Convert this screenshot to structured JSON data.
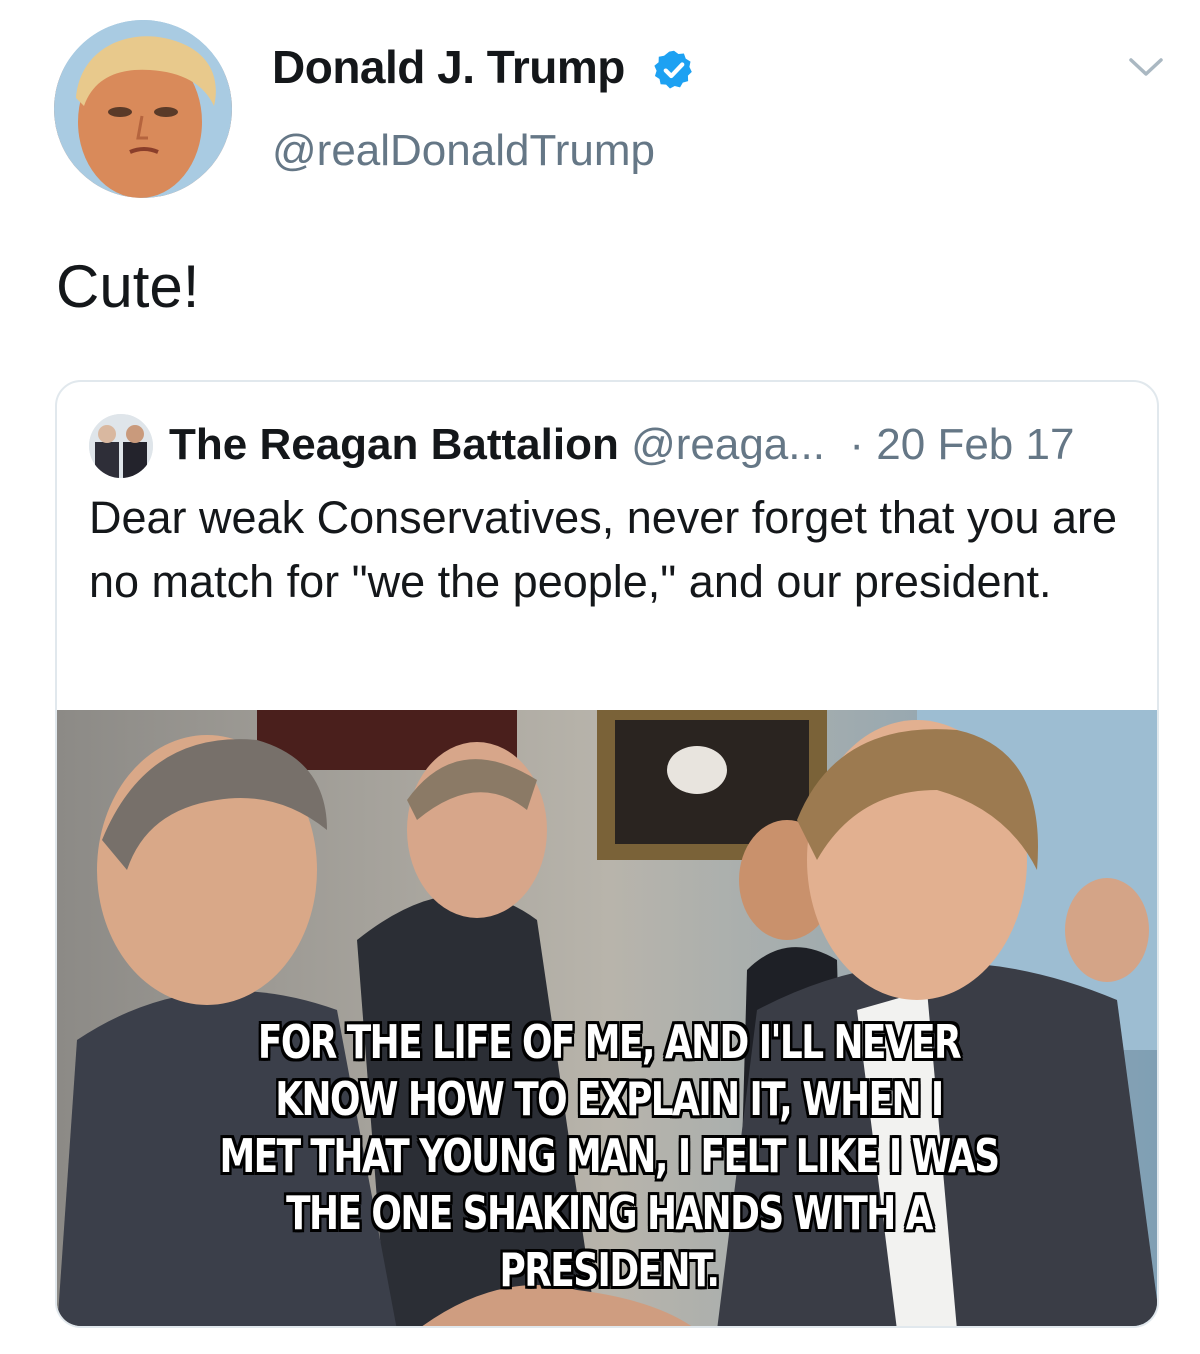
{
  "tweet": {
    "display_name": "Donald J. Trump",
    "handle": "@realDonaldTrump",
    "verified_icon": "verified-badge-icon",
    "menu_icon": "chevron-down-icon",
    "text": "Cute!"
  },
  "quoted_tweet": {
    "display_name": "The Reagan Battalion",
    "handle": "@reaga...",
    "date": "· 20 Feb 17",
    "text": "Dear weak Conservatives, never forget that you are no match for \"we the people,\" and our president.",
    "image": {
      "caption_lines": [
        "FOR THE LIFE OF ME, AND I'LL NEVER",
        "KNOW HOW TO EXPLAIN IT, WHEN I",
        "MET THAT YOUNG MAN, I FELT LIKE I WAS",
        "THE ONE SHAKING HANDS WITH A PRESIDENT."
      ]
    }
  },
  "colors": {
    "text_primary": "#14171a",
    "text_secondary": "#657786",
    "verified_blue": "#1da1f2",
    "border": "#e1e8ed"
  }
}
